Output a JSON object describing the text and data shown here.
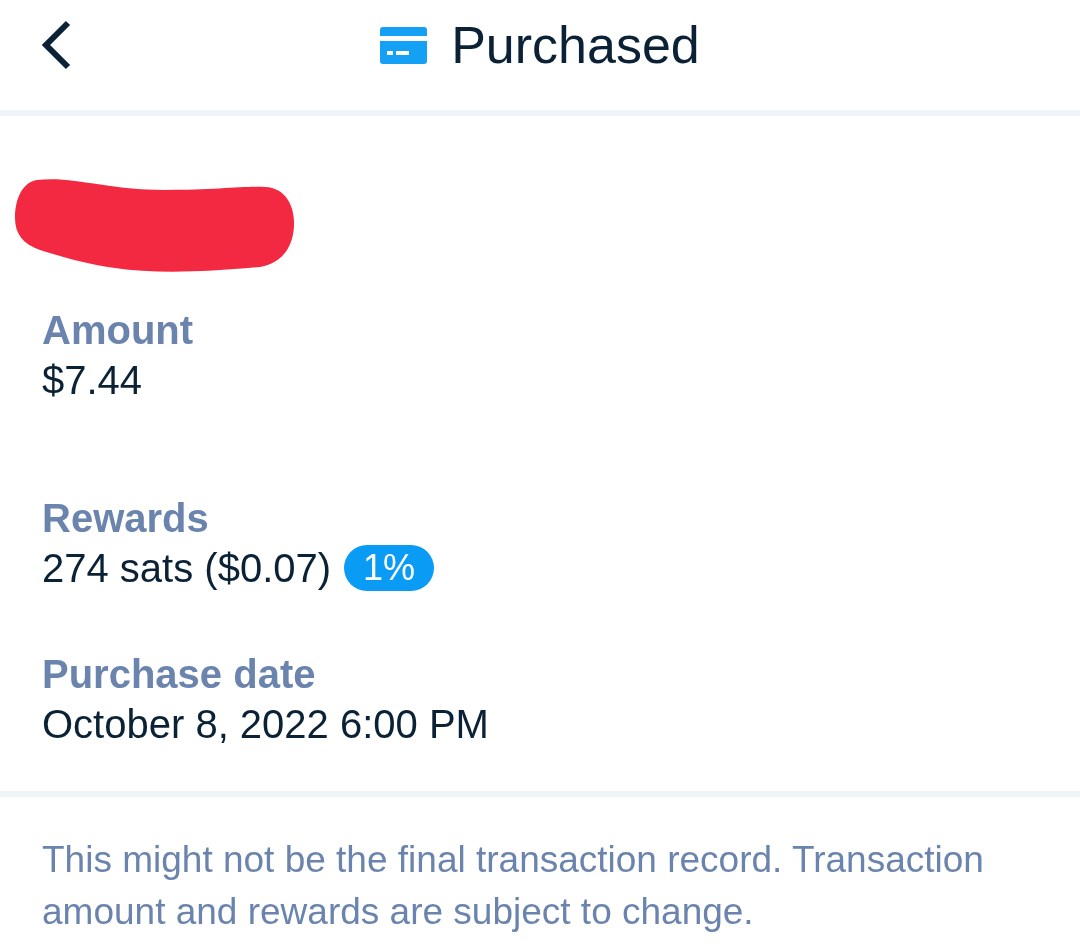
{
  "header": {
    "title": "Purchased"
  },
  "fields": [
    {
      "kind": "redacted"
    },
    {
      "kind": "plain",
      "label": "Amount",
      "value": "$7.44"
    },
    {
      "kind": "reward",
      "label": "Rewards",
      "value": "274 sats ($0.07)",
      "badge": "1%"
    },
    {
      "kind": "plain",
      "label": "Purchase date",
      "value": "October 8, 2022 6:00 PM"
    }
  ],
  "disclaimer": "This might not be the final transaction record. Transaction amount and rewards are subject to change."
}
